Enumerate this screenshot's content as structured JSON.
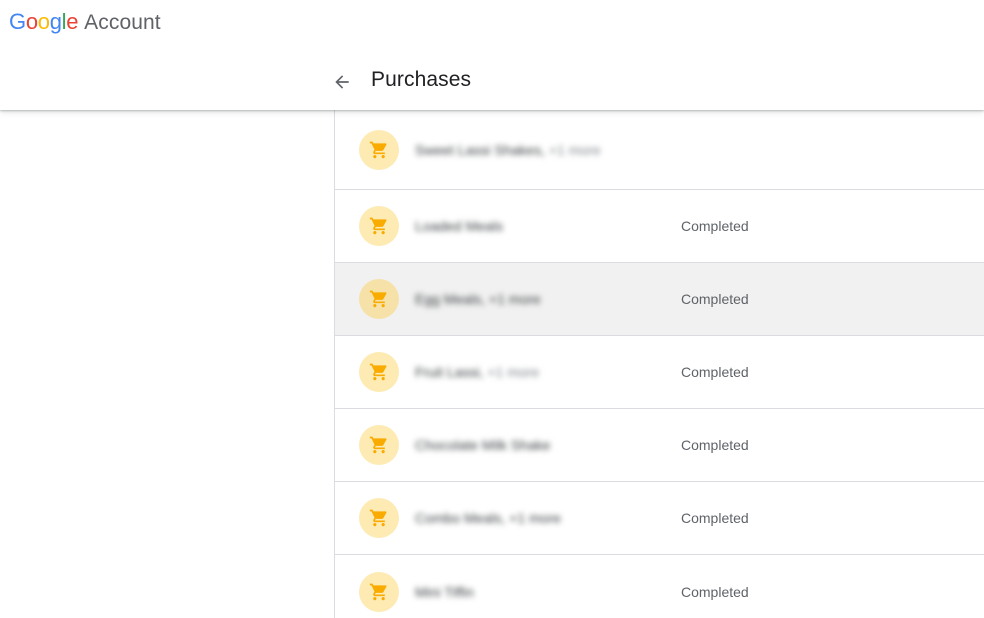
{
  "header": {
    "logo_letters": [
      {
        "char": "G",
        "color": "#4285F4"
      },
      {
        "char": "o",
        "color": "#EA4335"
      },
      {
        "char": "o",
        "color": "#FBBC05"
      },
      {
        "char": "g",
        "color": "#4285F4"
      },
      {
        "char": "l",
        "color": "#34A853"
      },
      {
        "char": "e",
        "color": "#EA4335"
      }
    ],
    "product": "Account",
    "back_icon": "arrow-back-icon",
    "page_title": "Purchases"
  },
  "colors": {
    "icon_bg": "#fdebb3",
    "icon_fg": "#f9ab00",
    "divider": "#dadce0",
    "hover_bg": "#f1f1f1"
  },
  "purchases": [
    {
      "title": "Sweet Lassi Shakes, ",
      "extra": "+1 more",
      "status": "",
      "icon": "shopping-cart-icon"
    },
    {
      "title": "Loaded Meals",
      "extra": "",
      "status": "Completed",
      "icon": "shopping-cart-icon"
    },
    {
      "title": "Egg Meals, +1 more",
      "extra": "",
      "status": "Completed",
      "icon": "shopping-cart-icon",
      "highlighted": true
    },
    {
      "title": "Fruit Lassi, ",
      "extra": "+1 more",
      "status": "Completed",
      "icon": "shopping-cart-icon"
    },
    {
      "title": "Chocolate Milk Shake",
      "extra": "",
      "status": "Completed",
      "icon": "shopping-cart-icon"
    },
    {
      "title": "Combo Meals, +1 more",
      "extra": "",
      "status": "Completed",
      "icon": "shopping-cart-icon"
    },
    {
      "title": "Mini Tiffin",
      "extra": "",
      "status": "Completed",
      "icon": "shopping-cart-icon"
    }
  ]
}
